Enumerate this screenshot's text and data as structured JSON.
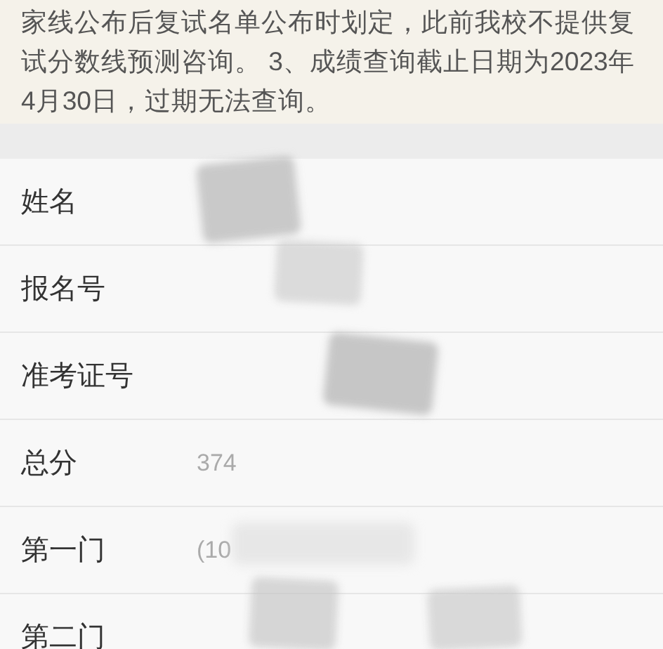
{
  "notice": {
    "text": "家线公布后复试名单公布时划定，此前我校不提供复试分数线预测咨询。 3、成绩查询截止日期为2023年4月30日，过期无法查询。"
  },
  "rows": [
    {
      "label": "姓名"
    },
    {
      "label": "报名号"
    },
    {
      "label": "准考证号"
    },
    {
      "label": "总分",
      "value": "374"
    },
    {
      "label": "第一门",
      "value": "(10"
    },
    {
      "label": "第二门"
    }
  ]
}
